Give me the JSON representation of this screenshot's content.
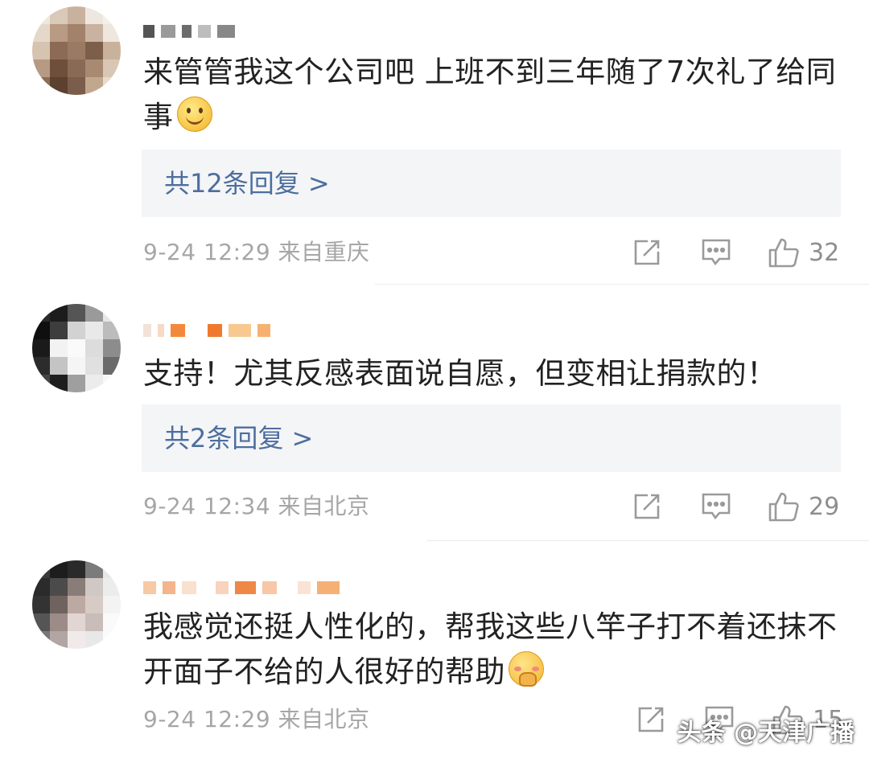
{
  "comments": [
    {
      "text": "来管管我这个公司吧 上班不到三年随了7次礼了给同事",
      "emoji": "slight-smile-emoji",
      "reply_label": "共12条回复 >",
      "time": "9-24 12:29",
      "location": "来自重庆",
      "likes": "32"
    },
    {
      "text": "支持！尤其反感表面说自愿，但变相让捐款的！",
      "emoji": "",
      "reply_label": "共2条回复 >",
      "time": "9-24 12:34",
      "location": "来自北京",
      "likes": "29"
    },
    {
      "text": "我感觉还挺人性化的，帮我这些八竿子打不着还抹不开面子不给的人很好的帮助",
      "emoji": "shy-emoji",
      "reply_label": "",
      "time": "9-24 12:29",
      "location": "来自北京",
      "likes": "15"
    }
  ],
  "icons": [
    "repost-icon",
    "comment-icon",
    "thumbs-up-icon"
  ],
  "colors": {
    "reply_link": "#4d6e9e",
    "meta_text": "#a6a6a6",
    "reply_bg": "#f4f5f7"
  },
  "watermark": "头条 @天津广播"
}
